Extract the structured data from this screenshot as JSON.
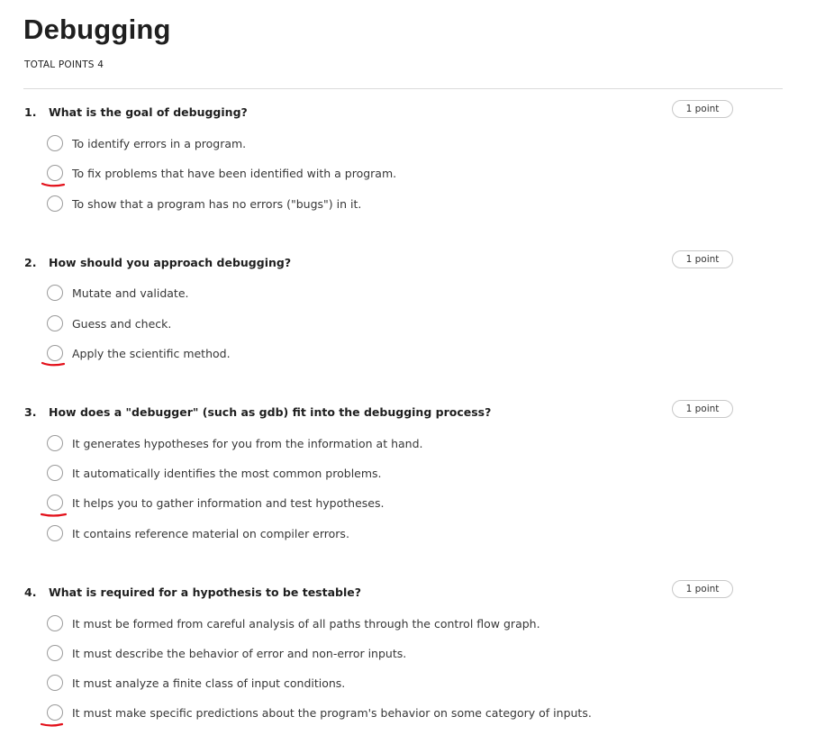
{
  "page": {
    "title": "Debugging",
    "total_points": "TOTAL POINTS 4"
  },
  "colors": {
    "annotation_red": "#e3101a",
    "radio_border": "#9b9b9b",
    "divider": "#dadada"
  },
  "questions": [
    {
      "number": "1.",
      "text": "What is the goal of debugging?",
      "points": "1 point",
      "options": [
        {
          "label": "To identify errors in a program.",
          "marked": false
        },
        {
          "label": "To fix problems that have been identified with a program.",
          "marked": true
        },
        {
          "label": "To show that a program has no errors (\"bugs\") in it.",
          "marked": false
        }
      ]
    },
    {
      "number": "2.",
      "text": "How should you approach debugging?",
      "points": "1 point",
      "options": [
        {
          "label": "Mutate and validate.",
          "marked": false
        },
        {
          "label": "Guess and check.",
          "marked": false
        },
        {
          "label": "Apply the scientific method.",
          "marked": true
        }
      ]
    },
    {
      "number": "3.",
      "text": "How does a \"debugger\" (such as gdb) fit into the debugging process?",
      "points": "1 point",
      "options": [
        {
          "label": "It generates hypotheses for you from the information at hand.",
          "marked": false
        },
        {
          "label": "It automatically identifies the most common problems.",
          "marked": false
        },
        {
          "label": "It helps you to gather information and test hypotheses.",
          "marked": true
        },
        {
          "label": "It contains reference material on compiler errors.",
          "marked": false
        }
      ]
    },
    {
      "number": "4.",
      "text": "What is required for a hypothesis to be testable?",
      "points": "1 point",
      "options": [
        {
          "label": "It must be formed from careful analysis of all paths through the control flow graph.",
          "marked": false
        },
        {
          "label": "It must describe the behavior of error and non-error inputs.",
          "marked": false
        },
        {
          "label": "It must analyze a finite class of input conditions.",
          "marked": false
        },
        {
          "label": "It must make specific predictions about the program's behavior on some category of inputs.",
          "marked": true
        }
      ]
    }
  ]
}
